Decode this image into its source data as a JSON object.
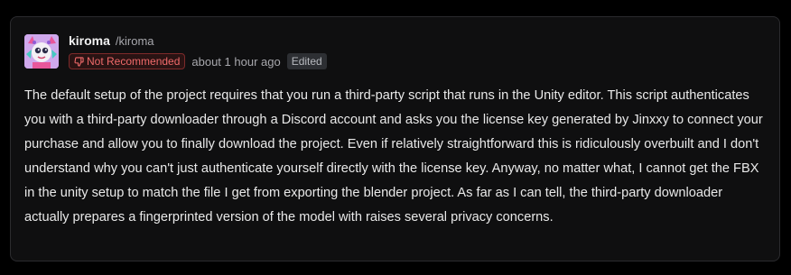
{
  "review": {
    "username": "kiroma",
    "handle": "/kiroma",
    "recommendation_label": "Not Recommended",
    "recommendation_icon": "thumbs-down-icon",
    "timestamp": "about 1 hour ago",
    "edited_label": "Edited",
    "body": "The default setup of the project requires that you run a third-party script that runs in the Unity editor. This script authenticates you with a third-party downloader through a Discord account and asks you the license key generated by Jinxxy to connect your purchase and allow you to finally download the project. Even if relatively straightforward this is ridiculously overbuilt and I don't understand why you can't just authenticate yourself directly with the license key. Anyway, no matter what, I cannot get the FBX in the unity setup to match the file I get from exporting the blender project. As far as I can tell, the third-party downloader actually prepares a fingerprinted version of the model with raises several privacy concerns."
  },
  "colors": {
    "page_background": "#000000",
    "card_background": "#0f0f10",
    "card_border": "#2b2b2e",
    "not_recommended": "#f06a6a",
    "edited_badge": "#2d2f33"
  }
}
